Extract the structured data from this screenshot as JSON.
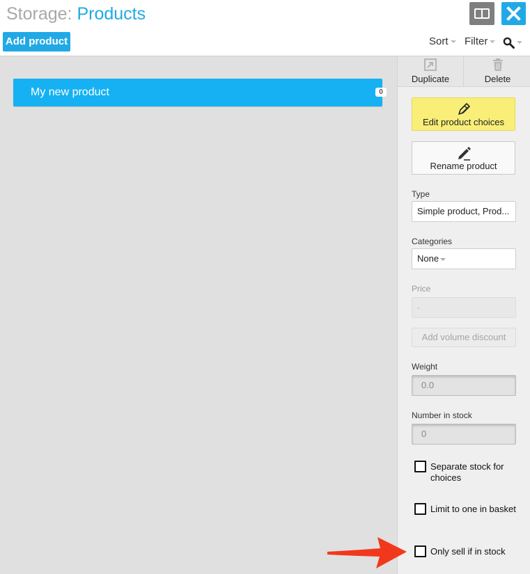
{
  "header": {
    "title_prefix": "Storage:",
    "title_main": "Products",
    "add_button": "Add product",
    "sort_label": "Sort",
    "filter_label": "Filter"
  },
  "products": [
    {
      "name": "My new product",
      "count": "0"
    }
  ],
  "panel": {
    "duplicate_label": "Duplicate",
    "delete_label": "Delete",
    "edit_choices_label": "Edit product choices",
    "rename_label": "Rename product",
    "type_label": "Type",
    "type_value": "Simple product, Prod...",
    "categories_label": "Categories",
    "categories_value": "None",
    "price_label": "Price",
    "price_value": "-",
    "volume_discount_label": "Add volume discount",
    "weight_label": "Weight",
    "weight_value": "0.0",
    "stock_label": "Number in stock",
    "stock_value": "0",
    "separate_stock_label": "Separate stock for choices",
    "limit_one_label": "Limit to one in basket",
    "only_sell_label": "Only sell if in stock"
  },
  "colors": {
    "accent": "#21a9e6",
    "product_item": "#15b1f3",
    "edit_button": "#f8ee78",
    "annotation_arrow": "#f2381c"
  }
}
